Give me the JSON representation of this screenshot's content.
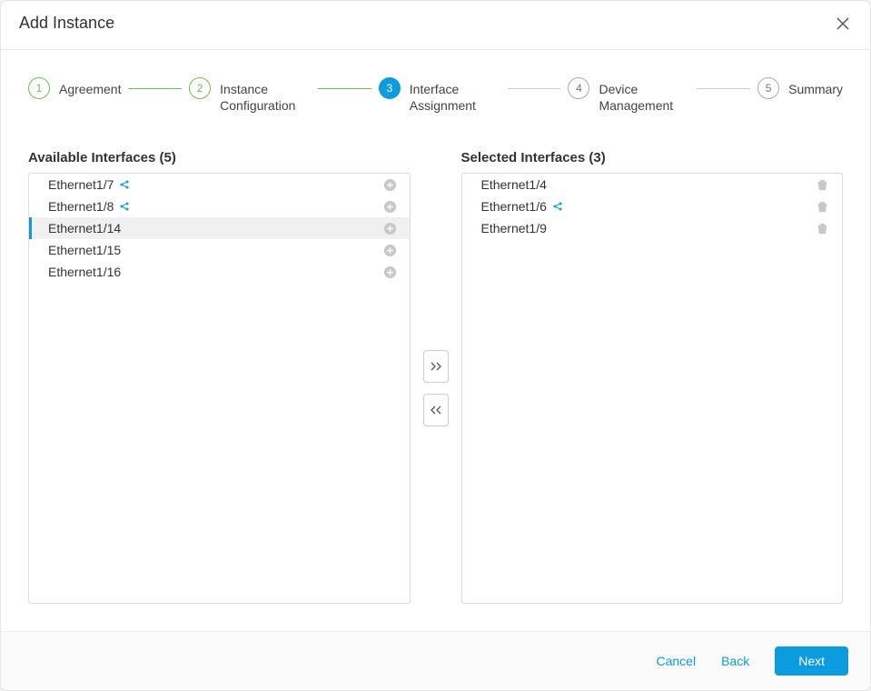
{
  "header": {
    "title": "Add Instance"
  },
  "steps": [
    {
      "num": "1",
      "label": "Agreement",
      "state": "done"
    },
    {
      "num": "2",
      "label": "Instance Configuration",
      "state": "done"
    },
    {
      "num": "3",
      "label": "Interface Assignment",
      "state": "active"
    },
    {
      "num": "4",
      "label": "Device Management",
      "state": "todo"
    },
    {
      "num": "5",
      "label": "Summary",
      "state": "todo"
    }
  ],
  "available": {
    "heading": "Available Interfaces (5)",
    "items": [
      {
        "name": "Ethernet1/7",
        "shared": true,
        "selected": false
      },
      {
        "name": "Ethernet1/8",
        "shared": true,
        "selected": false
      },
      {
        "name": "Ethernet1/14",
        "shared": false,
        "selected": true
      },
      {
        "name": "Ethernet1/15",
        "shared": false,
        "selected": false
      },
      {
        "name": "Ethernet1/16",
        "shared": false,
        "selected": false
      }
    ]
  },
  "selected": {
    "heading": "Selected Interfaces (3)",
    "items": [
      {
        "name": "Ethernet1/4",
        "shared": false
      },
      {
        "name": "Ethernet1/6",
        "shared": true
      },
      {
        "name": "Ethernet1/9",
        "shared": false
      }
    ]
  },
  "footer": {
    "cancel": "Cancel",
    "back": "Back",
    "next": "Next"
  }
}
